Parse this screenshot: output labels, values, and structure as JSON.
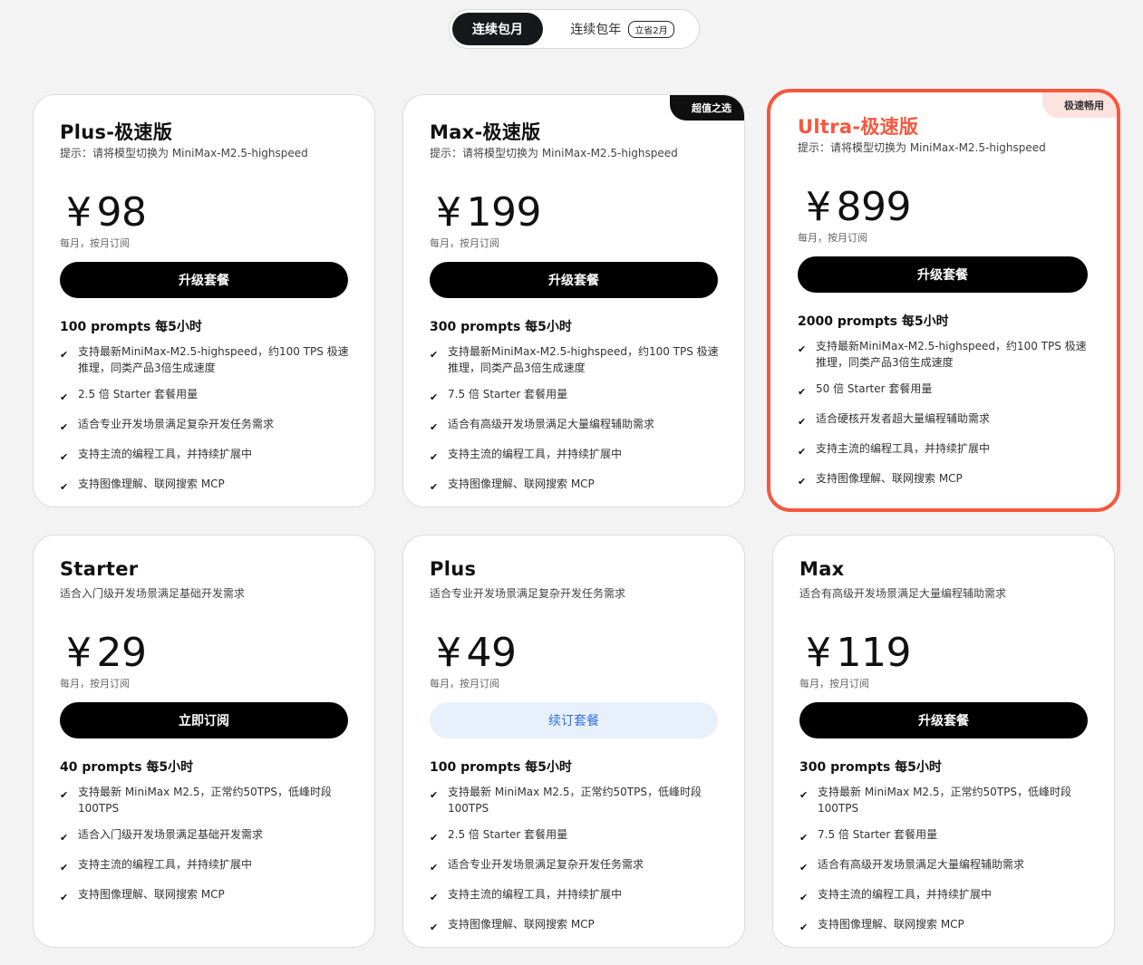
{
  "billing_toggle": {
    "monthly": "连续包月",
    "yearly": "连续包年",
    "yearly_badge": "立省2月"
  },
  "cards": [
    {
      "title": "Plus-极速版",
      "subtitle": "提示：请将模型切换为 MiniMax-M2.5-highspeed",
      "currency": "¥",
      "price": "98",
      "price_note": "每月，按月订阅",
      "cta": "升级套餐",
      "quota": "100 prompts 每5小时",
      "features": [
        "支持最新MiniMax-M2.5-highspeed，约100 TPS 极速推理，同类产品3倍生成速度",
        "2.5 倍 Starter 套餐用量",
        "适合专业开发场景满足复杂开发任务需求",
        "支持主流的编程工具，并持续扩展中",
        "支持图像理解、联网搜索 MCP"
      ]
    },
    {
      "title": "Max-极速版",
      "badge": "超值之选",
      "subtitle": "提示：请将模型切换为 MiniMax-M2.5-highspeed",
      "currency": "¥",
      "price": "199",
      "price_note": "每月，按月订阅",
      "cta": "升级套餐",
      "quota": "300 prompts 每5小时",
      "features": [
        "支持最新MiniMax-M2.5-highspeed，约100 TPS 极速推理，同类产品3倍生成速度",
        "7.5 倍 Starter 套餐用量",
        "适合有高级开发场景满足大量编程辅助需求",
        "支持主流的编程工具，并持续扩展中",
        "支持图像理解、联网搜索 MCP"
      ]
    },
    {
      "title": "Ultra-极速版",
      "badge": "极速畅用",
      "subtitle": "提示：请将模型切换为 MiniMax-M2.5-highspeed",
      "currency": "¥",
      "price": "899",
      "price_note": "每月，按月订阅",
      "cta": "升级套餐",
      "quota": "2000 prompts 每5小时",
      "features": [
        "支持最新MiniMax-M2.5-highspeed，约100 TPS 极速推理，同类产品3倍生成速度",
        "50 倍 Starter 套餐用量",
        "适合硬核开发者超大量编程辅助需求",
        "支持主流的编程工具，并持续扩展中",
        "支持图像理解、联网搜索 MCP"
      ]
    },
    {
      "title": "Starter",
      "subtitle": "适合入门级开发场景满足基础开发需求",
      "currency": "¥",
      "price": "29",
      "price_note": "每月，按月订阅",
      "cta": "立即订阅",
      "quota": "40 prompts 每5小时",
      "features": [
        "支持最新 MiniMax M2.5，正常约50TPS，低峰时段100TPS",
        "适合入门级开发场景满足基础开发需求",
        "支持主流的编程工具，并持续扩展中",
        "支持图像理解、联网搜索 MCP"
      ]
    },
    {
      "title": "Plus",
      "subtitle": "适合专业开发场景满足复杂开发任务需求",
      "currency": "¥",
      "price": "49",
      "price_note": "每月，按月订阅",
      "cta": "续订套餐",
      "quota": "100 prompts 每5小时",
      "features": [
        "支持最新 MiniMax M2.5，正常约50TPS，低峰时段100TPS",
        "2.5 倍 Starter 套餐用量",
        "适合专业开发场景满足复杂开发任务需求",
        "支持主流的编程工具，并持续扩展中",
        "支持图像理解、联网搜索 MCP"
      ]
    },
    {
      "title": "Max",
      "subtitle": "适合有高级开发场景满足大量编程辅助需求",
      "currency": "¥",
      "price": "119",
      "price_note": "每月，按月订阅",
      "cta": "升级套餐",
      "quota": "300 prompts 每5小时",
      "features": [
        "支持最新 MiniMax M2.5，正常约50TPS，低峰时段100TPS",
        "7.5 倍 Starter 套餐用量",
        "适合有高级开发场景满足大量编程辅助需求",
        "支持主流的编程工具，并持续扩展中",
        "支持图像理解、联网搜索 MCP"
      ]
    }
  ]
}
